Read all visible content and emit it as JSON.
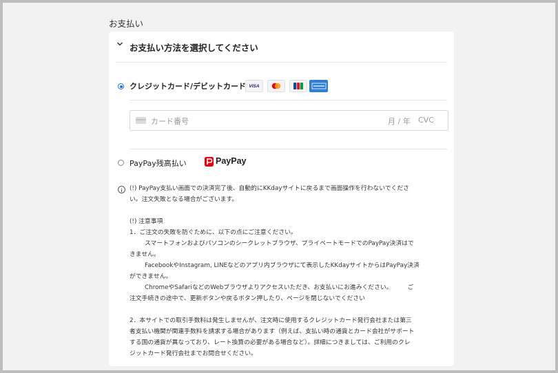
{
  "section": {
    "title": "お支払い"
  },
  "header": {
    "title": "お支払い方法を選択してください",
    "chevron_icon": "chevron-down-icon"
  },
  "options": {
    "card": {
      "label": "クレジットカード/デビットカード",
      "selected": true,
      "brands": [
        "VISA",
        "Mastercard",
        "JCB",
        "American Express"
      ],
      "card_number_placeholder": "カード番号",
      "expiry_placeholder": "月 / 年",
      "cvc_placeholder": "CVC",
      "card_icon": "credit-card-icon"
    },
    "paypay": {
      "label": "PayPay残高払い",
      "selected": false,
      "logo_text": "PayPay"
    }
  },
  "colors": {
    "radio_selected": "#2a6dd9",
    "paypay_red": "#e60012"
  },
  "notes": {
    "warning_line1": "(!) PayPay支払い画面での決済完了後、自動的にKKdayサイトに戻るまで画面操作を行わないでくださ",
    "warning_line2": "い。注文失敗となる場合がございます。",
    "heading": "(!) 注意事項",
    "item1": "1．ご注文の失敗を防ぐために、以下の点にご注意ください。",
    "item1_a1": "スマートフォンおよびパソコンのシークレットブラウザ、プライベートモードでのPayPay決済はで",
    "item1_a2": "きません。",
    "item1_b1": "FacebookやInstagram, LINEなどのアプリ内ブラウザにて表示したKKdayサイトからはPayPay決済",
    "item1_b2": "ができません。",
    "item1_c1": "ChromeやSafariなどのWebブラウザよりアクセスいただき、お支払いにお進みください。　　　ご",
    "item1_c2": "注文手続きの途中で、更新ボタンや戻るボタン押したり、ページを閉じないでください",
    "item2_1": "2．本サイトでの取引手数料は発生しませんが、注文時に使用するクレジットカード発行会社または第三",
    "item2_2": "者支払い機関が関連手数料を請求する場合があります（例えば、支払い時の通貨とカード会社がサポート",
    "item2_3": "する国の通貨が異なっており、レート換算の必要がある場合など）。詳細につきましては、ご利用のクレ",
    "item2_4": "ジットカード発行会社までお問合せください。"
  }
}
